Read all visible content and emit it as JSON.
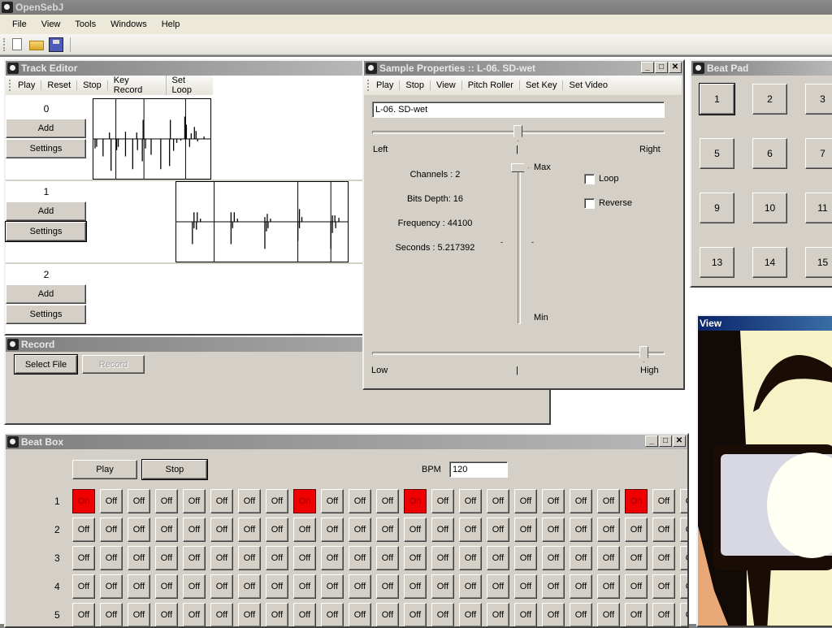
{
  "app": {
    "title": "OpenSebJ",
    "menu": [
      "File",
      "View",
      "Tools",
      "Windows",
      "Help"
    ],
    "toolbar_icons": [
      "new-file-icon",
      "open-folder-icon",
      "save-disk-icon"
    ]
  },
  "track_editor": {
    "title": "Track Editor",
    "toolbar": [
      "Play",
      "Reset",
      "Stop",
      "Key Record",
      "Set Loop"
    ],
    "tracks": [
      {
        "index": "0",
        "add_label": "Add",
        "settings_label": "Settings"
      },
      {
        "index": "1",
        "add_label": "Add",
        "settings_label": "Settings"
      },
      {
        "index": "2",
        "add_label": "Add",
        "settings_label": "Settings"
      }
    ]
  },
  "record": {
    "title": "Record",
    "select_file_label": "Select File",
    "record_label": "Record"
  },
  "sample_properties": {
    "title": "Sample Properties :: L-06. SD-wet",
    "toolbar": [
      "Play",
      "Stop",
      "View",
      "Pitch Roller",
      "Set Key",
      "Set Video"
    ],
    "name_value": "L-06. SD-wet",
    "pan": {
      "left_label": "Left",
      "right_label": "Right",
      "center_mark": "|",
      "value": 0.5
    },
    "info": {
      "channels": "Channels : 2",
      "bits_depth": "Bits Depth: 16",
      "frequency": "Frequency : 44100",
      "seconds": "Seconds : 5.217392"
    },
    "volume": {
      "max_label": "Max",
      "min_label": "Min",
      "value": 1.0
    },
    "loop_label": "Loop",
    "loop_checked": false,
    "reverse_label": "Reverse",
    "reverse_checked": false,
    "pitch": {
      "low_label": "Low",
      "high_label": "High",
      "center_mark": "|",
      "value": 0.93
    }
  },
  "beat_pad": {
    "title": "Beat Pad",
    "pads": [
      "1",
      "2",
      "3",
      "5",
      "6",
      "7",
      "9",
      "10",
      "11",
      "13",
      "14",
      "15"
    ]
  },
  "view": {
    "title": "View"
  },
  "beat_box": {
    "title": "Beat Box",
    "play_label": "Play",
    "stop_label": "Stop",
    "bpm_label": "BPM",
    "bpm_value": "120",
    "on_label": "On",
    "off_label": "Off",
    "on_color": "#f00000",
    "rows": [
      {
        "label": "1",
        "on_steps": [
          0,
          8,
          12,
          20
        ]
      },
      {
        "label": "2",
        "on_steps": []
      },
      {
        "label": "3",
        "on_steps": []
      },
      {
        "label": "4",
        "on_steps": []
      },
      {
        "label": "5",
        "on_steps": []
      }
    ],
    "visible_steps": 23
  }
}
